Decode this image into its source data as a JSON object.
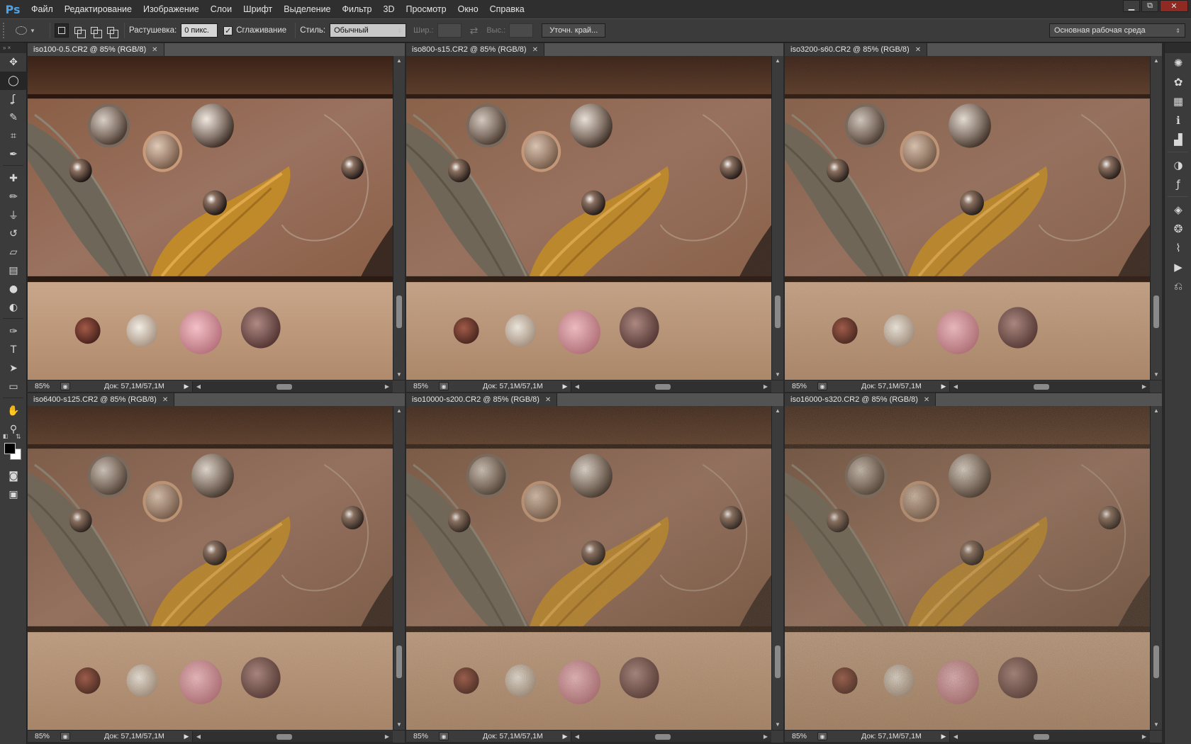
{
  "app": {
    "logo": "Ps"
  },
  "menu": [
    "Файл",
    "Редактирование",
    "Изображение",
    "Слои",
    "Шрифт",
    "Выделение",
    "Фильтр",
    "3D",
    "Просмотр",
    "Окно",
    "Справка"
  ],
  "window_controls": {
    "minimize": "▁",
    "restore": "⧉",
    "close": "✕"
  },
  "options": {
    "feather_label": "Растушевка:",
    "feather_value": "0 пикс.",
    "antialias_label": "Сглаживание",
    "antialias_checked": "✓",
    "style_label": "Стиль:",
    "style_value": "Обычный",
    "width_label": "Шир.:",
    "height_label": "Выс.:",
    "refine_label": "Уточн. край...",
    "workspace_value": "Основная рабочая среда"
  },
  "tools": [
    {
      "name": "move-tool",
      "glyph": "✥"
    },
    {
      "name": "elliptical-marquee-tool",
      "glyph": "◯"
    },
    {
      "name": "lasso-tool",
      "glyph": "ʆ"
    },
    {
      "name": "quick-selection-tool",
      "glyph": "✎"
    },
    {
      "name": "crop-tool",
      "glyph": "⌗"
    },
    {
      "name": "eyedropper-tool",
      "glyph": "✒"
    },
    {
      "name": "healing-brush-tool",
      "glyph": "✚"
    },
    {
      "name": "brush-tool",
      "glyph": "✏"
    },
    {
      "name": "clone-stamp-tool",
      "glyph": "⏚"
    },
    {
      "name": "history-brush-tool",
      "glyph": "↺"
    },
    {
      "name": "eraser-tool",
      "glyph": "▱"
    },
    {
      "name": "gradient-tool",
      "glyph": "▤"
    },
    {
      "name": "blur-tool",
      "glyph": "●"
    },
    {
      "name": "dodge-tool",
      "glyph": "◐"
    },
    {
      "name": "pen-tool",
      "glyph": "✑"
    },
    {
      "name": "type-tool",
      "glyph": "T"
    },
    {
      "name": "path-selection-tool",
      "glyph": "➤"
    },
    {
      "name": "rectangle-tool",
      "glyph": "▭"
    },
    {
      "name": "hand-tool",
      "glyph": "✋"
    },
    {
      "name": "zoom-tool",
      "glyph": "⚲"
    }
  ],
  "dock_icons": [
    {
      "name": "navigator-icon",
      "glyph": "✺"
    },
    {
      "name": "color-icon",
      "glyph": "✿"
    },
    {
      "name": "swatches-icon",
      "glyph": "▦"
    },
    {
      "name": "info-icon",
      "glyph": "ℹ"
    },
    {
      "name": "histogram-icon",
      "glyph": "▟"
    },
    {
      "name": "adjustments-icon",
      "glyph": "◑"
    },
    {
      "name": "styles-icon",
      "glyph": "ƒ"
    },
    {
      "name": "layers-icon",
      "glyph": "◈"
    },
    {
      "name": "channels-icon",
      "glyph": "❂"
    },
    {
      "name": "paths-icon",
      "glyph": "⌇"
    },
    {
      "name": "actions-icon",
      "glyph": "▶"
    },
    {
      "name": "history-icon",
      "glyph": "⎌"
    }
  ],
  "documents": [
    {
      "title": "iso100-0.5.CR2 @ 85% (RGB/8)",
      "zoom": "85%",
      "size": "Док: 57,1M/57,1M",
      "noise": 0.0,
      "tint": "#8a5e45"
    },
    {
      "title": "iso800-s15.CR2 @ 85% (RGB/8)",
      "zoom": "85%",
      "size": "Док: 57,1M/57,1M",
      "noise": 0.15,
      "tint": "#8b6148"
    },
    {
      "title": "iso3200-s60.CR2 @ 85% (RGB/8)",
      "zoom": "85%",
      "size": "Док: 57,1M/57,1M",
      "noise": 0.35,
      "tint": "#88604a"
    },
    {
      "title": "iso6400-s125.CR2 @ 85% (RGB/8)",
      "zoom": "85%",
      "size": "Док: 57,1M/57,1M",
      "noise": 0.55,
      "tint": "#7e5a46"
    },
    {
      "title": "iso10000-s200.CR2 @ 85% (RGB/8)",
      "zoom": "85%",
      "size": "Док: 57,1M/57,1M",
      "noise": 0.75,
      "tint": "#7a5640"
    },
    {
      "title": "iso16000-s320.CR2 @ 85% (RGB/8)",
      "zoom": "85%",
      "size": "Док: 57,1M/57,1M",
      "noise": 0.95,
      "tint": "#70503c"
    }
  ]
}
